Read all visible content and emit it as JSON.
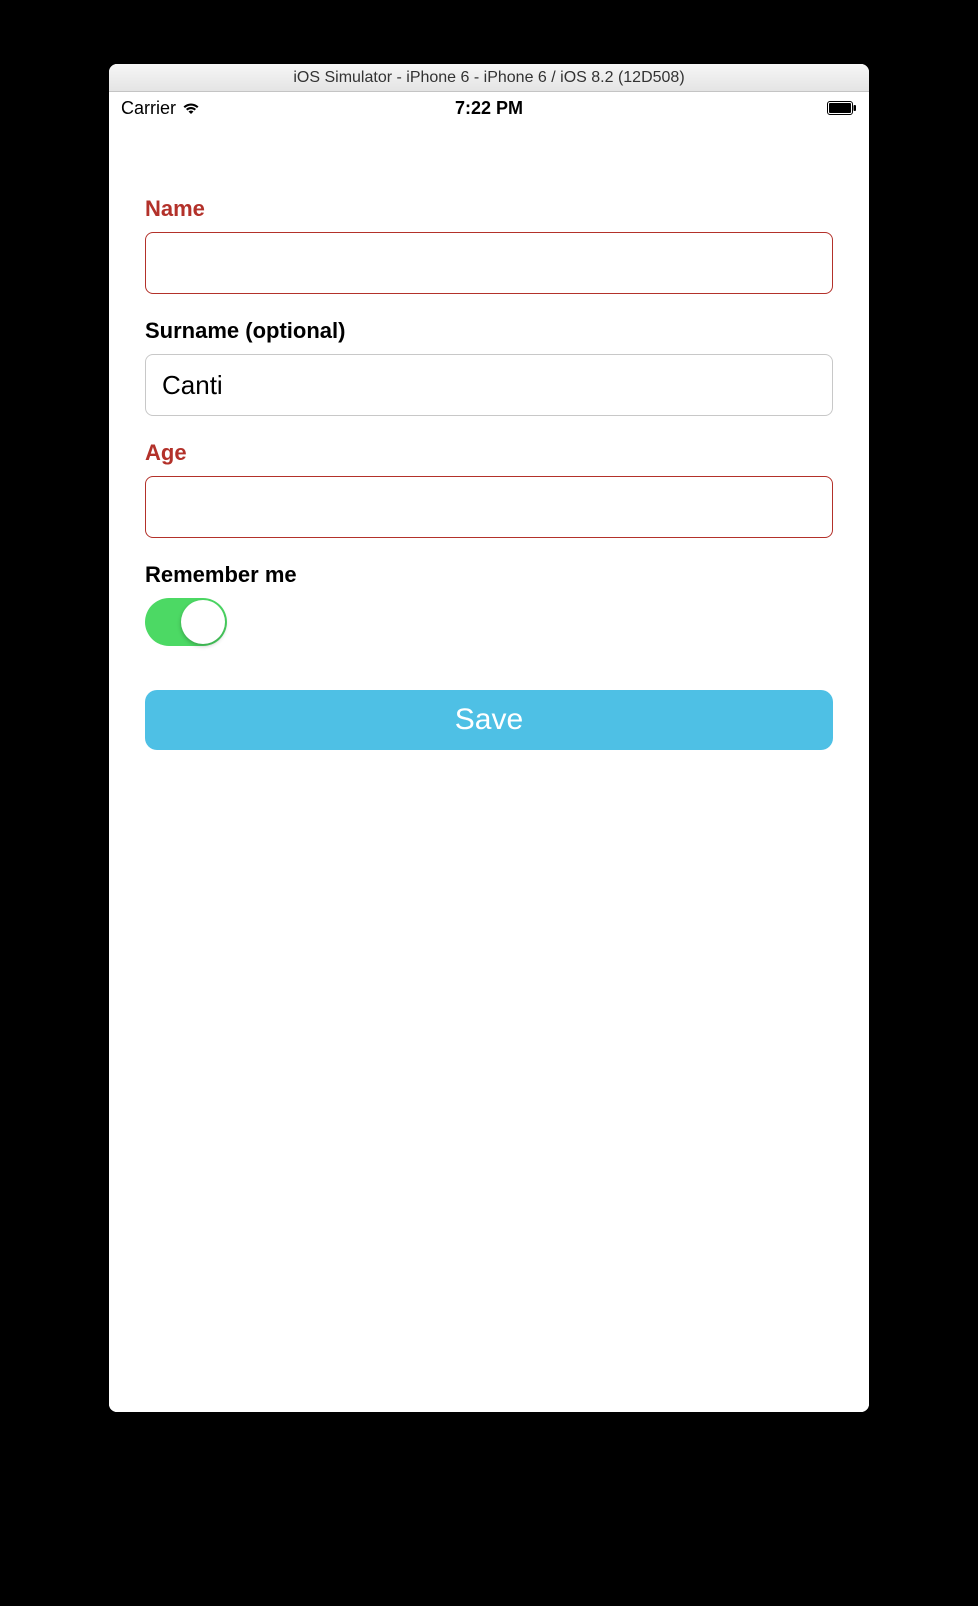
{
  "window": {
    "title": "iOS Simulator - iPhone 6 - iPhone 6 / iOS 8.2 (12D508)"
  },
  "statusBar": {
    "carrier": "Carrier",
    "time": "7:22 PM"
  },
  "form": {
    "name": {
      "label": "Name",
      "value": "",
      "error": true
    },
    "surname": {
      "label": "Surname (optional)",
      "value": "Canti",
      "error": false,
      "focused": true
    },
    "age": {
      "label": "Age",
      "value": "",
      "error": true
    },
    "remember": {
      "label": "Remember me",
      "on": true
    },
    "saveButton": "Save"
  }
}
